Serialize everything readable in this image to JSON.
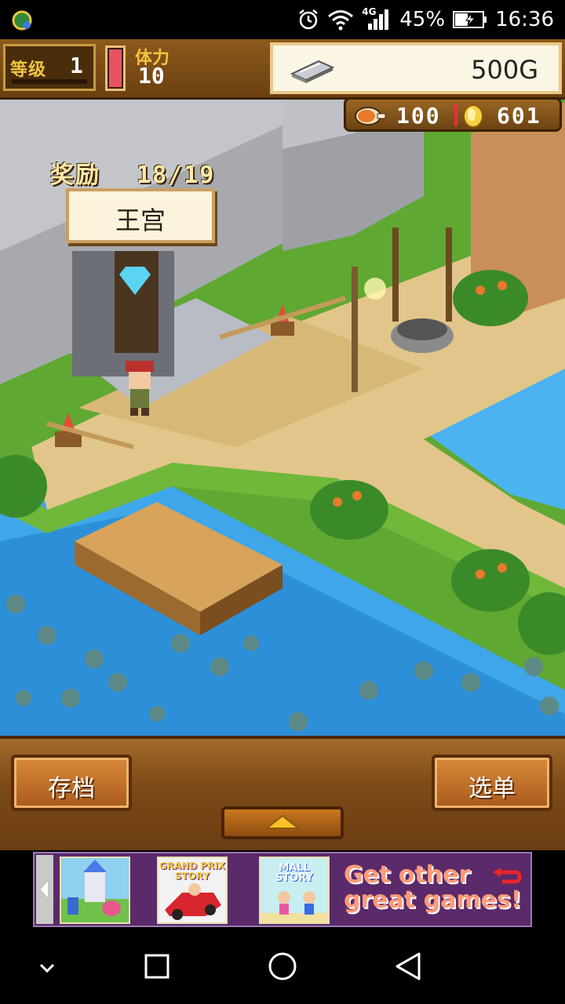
{
  "status_bar": {
    "network_type": "4G",
    "battery_percent": "45%",
    "time": "16:36",
    "icons": [
      "app-notification-icon",
      "alarm-icon",
      "wifi-icon",
      "signal-icon",
      "battery-charging-icon"
    ]
  },
  "hud": {
    "level_label": "等级",
    "level_value": "1",
    "stamina_label": "体力",
    "stamina_value": "10",
    "stamina_fill_fraction": 1.0,
    "gold": "500G",
    "food": "100",
    "coins": "601"
  },
  "map": {
    "reward_label": "奖励",
    "reward_progress": "18/19",
    "location_name": "王宫"
  },
  "bottom_menu": {
    "save_label": "存档",
    "menu_label": "选单"
  },
  "ad": {
    "apps": [
      {
        "name": "castle-game-app",
        "title": ""
      },
      {
        "name": "grand-prix-story-app",
        "title": "GRAND PRIX STORY"
      },
      {
        "name": "mall-story-app",
        "title": "MALL STORY"
      }
    ],
    "cta_line1": "Get other",
    "cta_line2": "great games!"
  },
  "nav_bar": {
    "icons": [
      "collapse-icon",
      "recents-icon",
      "home-icon",
      "back-icon"
    ]
  },
  "colors": {
    "hud_wood": "#8c5a1c",
    "gold_panel": "#fbf6e4",
    "water": "#3fa6ea",
    "sand": "#e2c58a",
    "grass": "#6fb83a",
    "stone": "#a7a9ae"
  }
}
